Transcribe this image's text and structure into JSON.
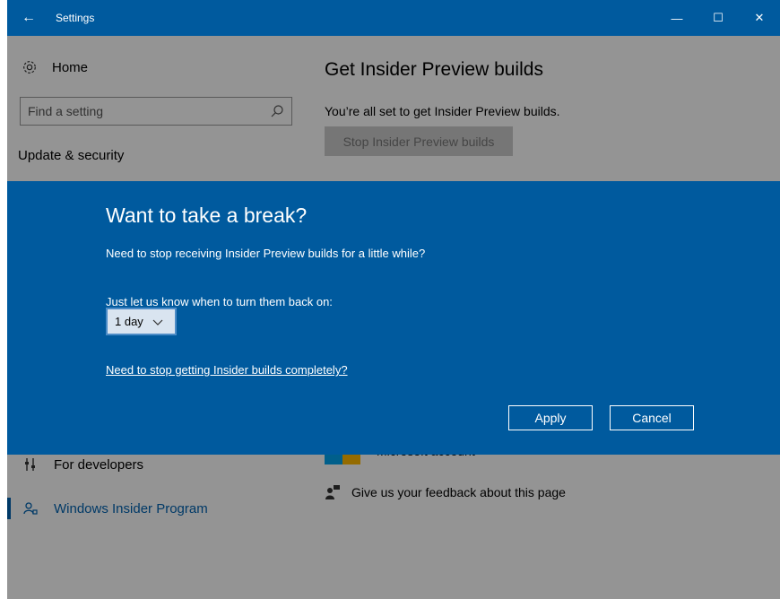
{
  "window": {
    "title": "Settings",
    "back_glyph": "←",
    "minimize_glyph": "—",
    "maximize_glyph": "☐",
    "close_glyph": "✕",
    "accent_color": "#005a9e"
  },
  "sidebar": {
    "home_label": "Home",
    "search_placeholder": "Find a setting",
    "section_label": "Update & security",
    "items": [
      {
        "label": "For developers",
        "icon": "developers-icon"
      },
      {
        "label": "Windows Insider Program",
        "icon": "insider-icon",
        "active": true
      }
    ]
  },
  "main": {
    "title": "Get Insider Preview builds",
    "status_text": "You’re all set to get Insider Preview builds.",
    "stop_button_label": "Stop Insider Preview builds",
    "ms_account_label": "Microsoft account",
    "feedback_label": "Give us your feedback about this page"
  },
  "dialog": {
    "title": "Want to take a break?",
    "text": "Need to stop receiving Insider Preview builds for a little while?",
    "prompt": "Just let us know when to turn them back on:",
    "selected_option": "1 day",
    "link": "Need to stop getting Insider builds completely?",
    "apply_label": "Apply",
    "cancel_label": "Cancel"
  }
}
